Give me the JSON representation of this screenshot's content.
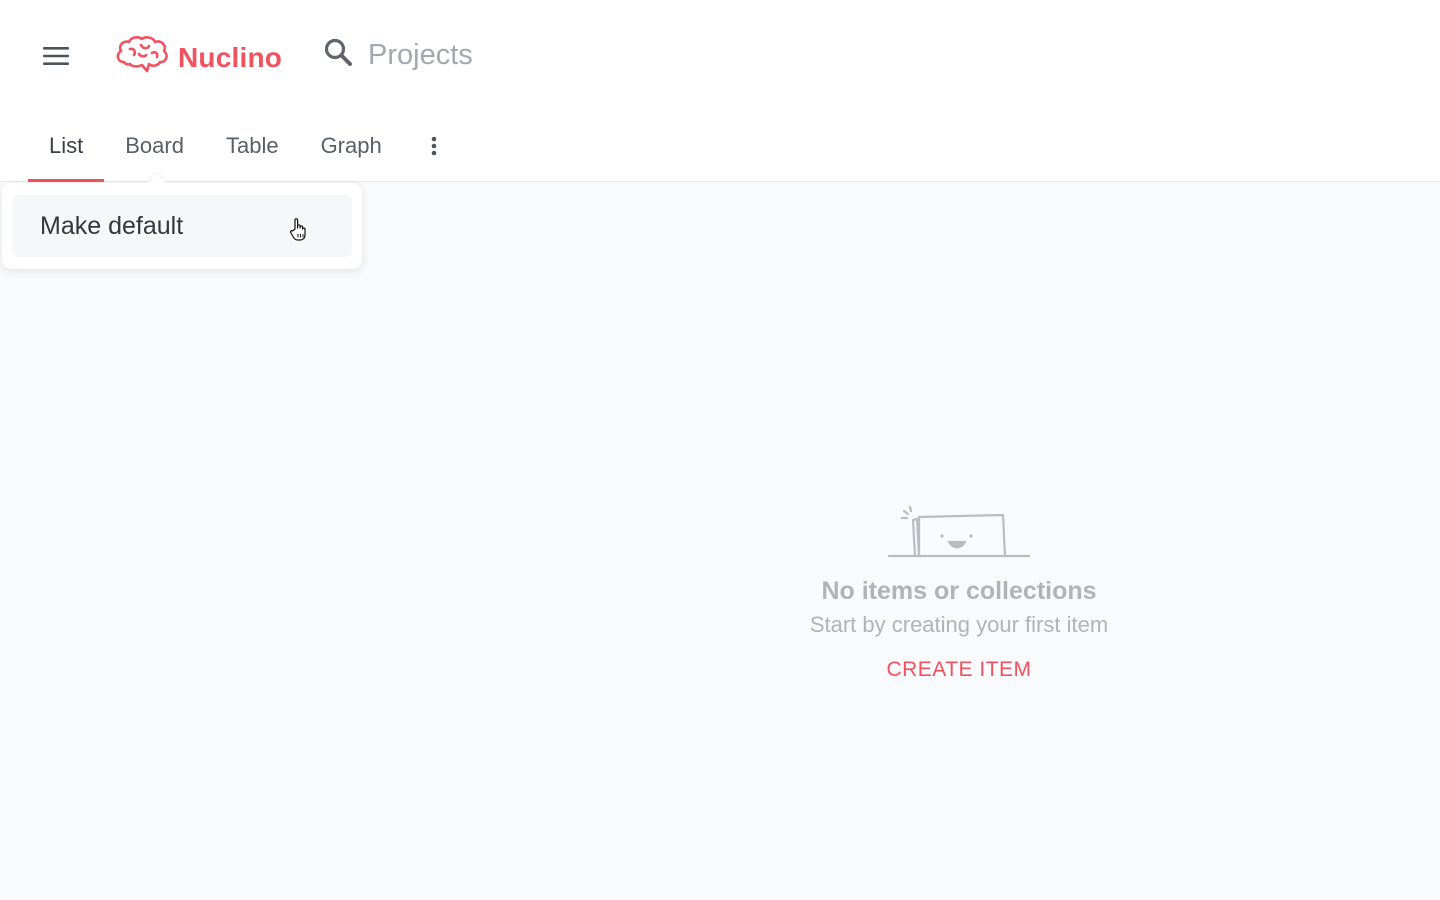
{
  "header": {
    "menu_icon": "hamburger-menu-icon",
    "logo_icon": "brain-logo-icon",
    "app_name": "Nuclino",
    "search_icon": "search-icon",
    "search_placeholder": "Projects"
  },
  "tabs": [
    {
      "label": "List",
      "active": true
    },
    {
      "label": "Board",
      "active": false
    },
    {
      "label": "Table",
      "active": false
    },
    {
      "label": "Graph",
      "active": false
    }
  ],
  "more_icon": "more-vertical-icon",
  "dropdown": {
    "items": [
      {
        "label": "Make default"
      }
    ]
  },
  "empty_state": {
    "illustration": "smiling-box-icon",
    "title": "No items or collections",
    "subtitle": "Start by creating your first item",
    "action": "CREATE ITEM"
  },
  "colors": {
    "accent": "#f0525f",
    "muted_text": "#b0b4b9",
    "background": "#f9fafb"
  }
}
